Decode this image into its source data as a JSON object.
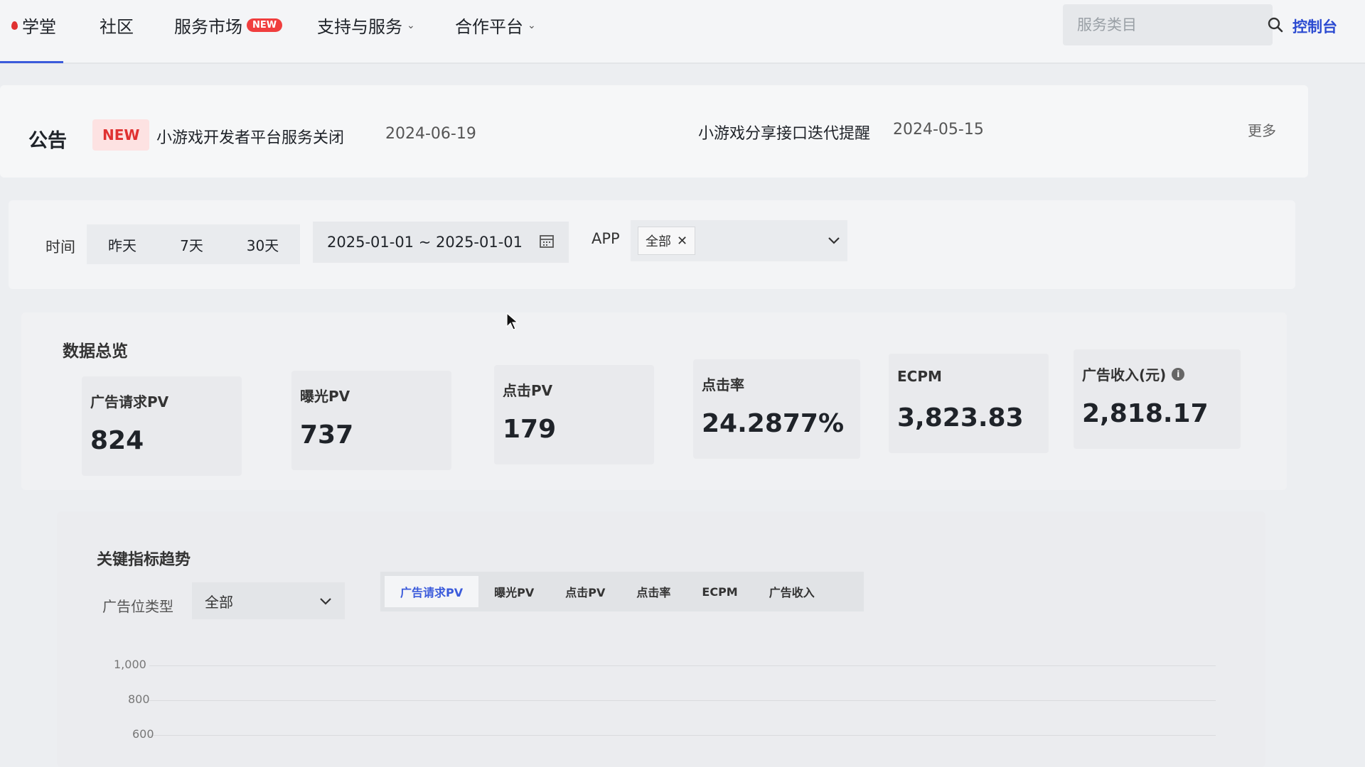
{
  "nav": {
    "items": [
      {
        "label": "学堂"
      },
      {
        "label": "社区"
      },
      {
        "label": "服务市场",
        "badge": "NEW"
      },
      {
        "label": "支持与服务"
      },
      {
        "label": "合作平台"
      }
    ],
    "search_placeholder": "服务类目",
    "console": "控制台"
  },
  "announcement": {
    "title": "公告",
    "badge": "NEW",
    "items": [
      {
        "text": "小游戏开发者平台服务关闭",
        "date": "2024-06-19"
      },
      {
        "text": "小游戏分享接口迭代提醒",
        "date": "2024-05-15"
      }
    ],
    "more": "更多"
  },
  "filter": {
    "time_label": "时间",
    "ranges": [
      "昨天",
      "7天",
      "30天"
    ],
    "date_range": "2025-01-01 ~ 2025-01-01",
    "app_label": "APP",
    "app_tag": "全部"
  },
  "overview": {
    "title": "数据总览",
    "metrics": [
      {
        "label": "广告请求PV",
        "value": "824"
      },
      {
        "label": "曝光PV",
        "value": "737"
      },
      {
        "label": "点击PV",
        "value": "179"
      },
      {
        "label": "点击率",
        "value": "24.2877%"
      },
      {
        "label": "ECPM",
        "value": "3,823.83"
      },
      {
        "label": "广告收入(元)",
        "value": "2,818.17"
      }
    ]
  },
  "trend": {
    "title": "关键指标趋势",
    "slot_label": "广告位类型",
    "slot_value": "全部",
    "tabs": [
      "广告请求PV",
      "曝光PV",
      "点击PV",
      "点击率",
      "ECPM",
      "广告收入"
    ],
    "active_tab": 0,
    "y_ticks": [
      "1,000",
      "800",
      "600"
    ]
  },
  "colors": {
    "accent": "#3b5bdb",
    "badge_red": "#f03e3e"
  }
}
